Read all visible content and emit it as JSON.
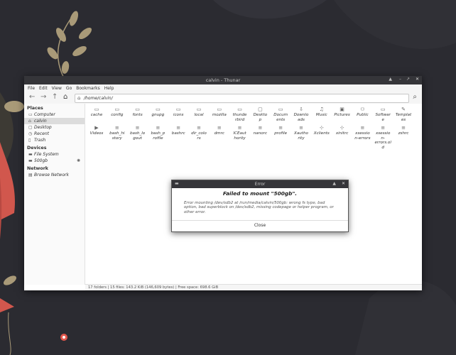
{
  "window": {
    "title": "calvin - Thunar"
  },
  "menu": [
    "File",
    "Edit",
    "View",
    "Go",
    "Bookmarks",
    "Help"
  ],
  "location": {
    "path": "/home/calvin/"
  },
  "sidebar": {
    "places_heading": "Places",
    "places": [
      {
        "label": "Computer",
        "icon": "computer-icon"
      },
      {
        "label": "calvin",
        "icon": "home-icon"
      },
      {
        "label": "Desktop",
        "icon": "desktop-icon"
      },
      {
        "label": "Recent",
        "icon": "recent-icon"
      },
      {
        "label": "Trash",
        "icon": "trash-icon"
      }
    ],
    "devices_heading": "Devices",
    "devices": [
      {
        "label": "File System",
        "icon": "drive-icon"
      },
      {
        "label": "500gb",
        "icon": "drive-icon"
      }
    ],
    "network_heading": "Network",
    "network": [
      {
        "label": "Browse Network",
        "icon": "network-icon"
      }
    ]
  },
  "files_row1": [
    {
      "name": "cache",
      "icon": "folder-icon"
    },
    {
      "name": "config",
      "icon": "folder-icon"
    },
    {
      "name": "fonts",
      "icon": "folder-icon"
    },
    {
      "name": "gnupg",
      "icon": "folder-icon"
    },
    {
      "name": "icons",
      "icon": "folder-icon"
    },
    {
      "name": "local",
      "icon": "folder-icon"
    },
    {
      "name": "mozilla",
      "icon": "folder-icon"
    },
    {
      "name": "thunde\nrbird",
      "icon": "folder-icon"
    },
    {
      "name": "Deskto\np",
      "icon": "desktop-icon"
    },
    {
      "name": "Docum\nents",
      "icon": "folder-icon"
    },
    {
      "name": "Downlo\nads",
      "icon": "download-icon"
    },
    {
      "name": "Music",
      "icon": "music-icon"
    },
    {
      "name": "Pictures",
      "icon": "picture-icon"
    },
    {
      "name": "Public",
      "icon": "public-icon"
    },
    {
      "name": "Softwar\ne",
      "icon": "folder-icon"
    },
    {
      "name": "Templat\nes",
      "icon": "template-icon"
    }
  ],
  "files_row2": [
    {
      "name": "Videos",
      "icon": "video-icon"
    },
    {
      "name": "bash_hi\nstory",
      "icon": "text-file-icon"
    },
    {
      "name": "bash_lo\ngout",
      "icon": "text-file-icon"
    },
    {
      "name": "bash_p\nrofile",
      "icon": "text-file-icon"
    },
    {
      "name": "bashrc",
      "icon": "text-file-icon"
    },
    {
      "name": "dir_colo\nrs",
      "icon": "text-file-icon"
    },
    {
      "name": "dmrc",
      "icon": "text-file-icon"
    },
    {
      "name": "ICEaut\nhority",
      "icon": "text-file-icon"
    },
    {
      "name": "nanorc",
      "icon": "text-file-icon"
    },
    {
      "name": "profile",
      "icon": "text-file-icon"
    },
    {
      "name": "Xautho\nrity",
      "icon": "text-file-icon"
    },
    {
      "name": "Xclients",
      "icon": "script-icon"
    },
    {
      "name": "xinitrc",
      "icon": "script-icon"
    },
    {
      "name": "xsessio\nn-errors",
      "icon": "text-file-icon"
    },
    {
      "name": "xsessio\nn-\nerrors.ol\nd",
      "icon": "text-file-icon"
    },
    {
      "name": "zshrc",
      "icon": "text-file-icon"
    }
  ],
  "status": "17 folders  |  15 files: 143.2 KiB (146,609 bytes)  |  Free space: 698.6 GiB",
  "dialog": {
    "title": "Error",
    "heading": "Failed to mount \"500gb\".",
    "message": "Error mounting /dev/sdb2 at /run/media/calvin/500gb: wrong fs type, bad option, bad superblock on /dev/sdb2, missing codepage or helper program, or other error.",
    "close_label": "Close"
  },
  "colors": {
    "titlebar": "#353539",
    "desktop_bg": "#2b2b31",
    "accent_red": "#e2574c"
  }
}
